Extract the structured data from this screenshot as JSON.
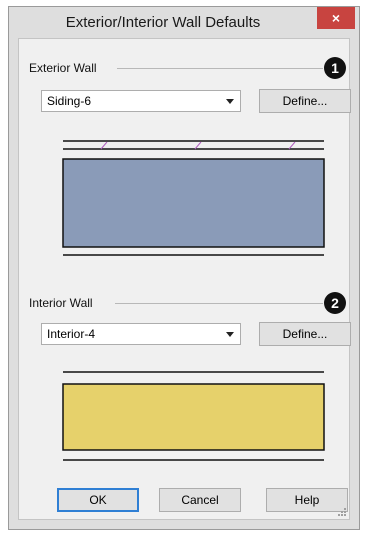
{
  "window": {
    "title": "Exterior/Interior Wall Defaults",
    "close_glyph": "×"
  },
  "exterior": {
    "label": "Exterior Wall",
    "callout": "1",
    "wall_type": "Siding-6",
    "define_label": "Define...",
    "fill_color": "#8a9bb8",
    "hatch_color": "#b05fbf"
  },
  "interior": {
    "label": "Interior Wall",
    "callout": "2",
    "wall_type": "Interior-4",
    "define_label": "Define...",
    "fill_color": "#e6d16b"
  },
  "buttons": {
    "ok": "OK",
    "cancel": "Cancel",
    "help": "Help"
  },
  "icons": {
    "close": "close-icon",
    "dropdown": "chevron-down-icon",
    "resize": "resize-grip-icon"
  }
}
